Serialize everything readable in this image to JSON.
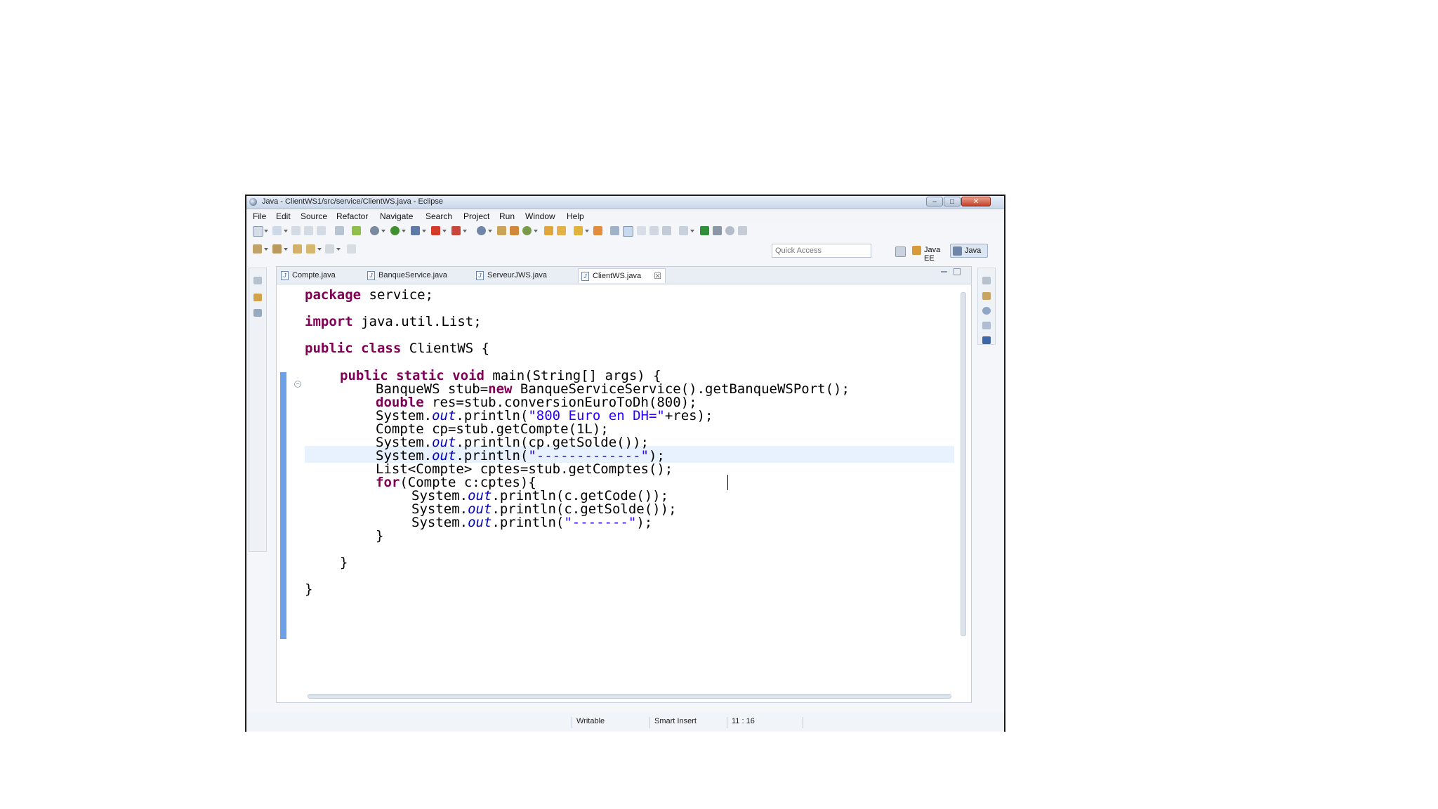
{
  "window": {
    "title": "Java - ClientWS1/src/service/ClientWS.java - Eclipse",
    "controls": {
      "minimize": "–",
      "maximize": "□",
      "close": "✕"
    }
  },
  "menu": [
    "File",
    "Edit",
    "Source",
    "Refactor",
    "Navigate",
    "Search",
    "Project",
    "Run",
    "Window",
    "Help"
  ],
  "quick_access": {
    "placeholder": "Quick Access"
  },
  "perspectives": [
    {
      "label": "Java EE",
      "icon": "java-ee-perspective-icon"
    },
    {
      "label": "Java",
      "icon": "java-perspective-icon",
      "active": true
    }
  ],
  "tabs": [
    {
      "label": "Compte.java"
    },
    {
      "label": "BanqueService.java"
    },
    {
      "label": "ServeurJWS.java"
    },
    {
      "label": "ClientWS.java",
      "active": true,
      "close": "☒"
    }
  ],
  "code": {
    "l1_kw": "package",
    "l1_rest": " service;",
    "l2_kw": "import",
    "l2_rest": " java.util.List;",
    "l3_kw1": "public",
    "l3_kw2": "class",
    "l3_rest": " ClientWS {",
    "l4_kw1": "public",
    "l4_kw2": "static",
    "l4_kw3": "void",
    "l4_rest": " main(String[] args) {",
    "l5_a": "BanqueWS stub=",
    "l5_kw": "new",
    "l5_b": " BanqueServiceService().getBanqueWSPort();",
    "l6_kw": "double",
    "l6_rest": " res=stub.conversionEuroToDh(800);",
    "l7_a": "System.",
    "l7_fld": "out",
    "l7_b": ".println(",
    "l7_str": "\"800 Euro en DH=\"",
    "l7_c": "+res);",
    "l8": "Compte cp=stub.getCompte(1L);",
    "l9_a": "System.",
    "l9_fld": "out",
    "l9_b": ".println(cp.getSolde());",
    "l10_a": "System.",
    "l10_fld": "out",
    "l10_b": ".println(",
    "l10_str": "\"-------------\"",
    "l10_c": ");",
    "l11": "List<Compte> cptes=stub.getComptes();",
    "l12_kw": "for",
    "l12_rest": "(Compte c:cptes){",
    "l13_a": "System.",
    "l13_fld": "out",
    "l13_b": ".println(c.getCode());",
    "l14_a": "System.",
    "l14_fld": "out",
    "l14_b": ".println(c.getSolde());",
    "l15_a": "System.",
    "l15_fld": "out",
    "l15_b": ".println(",
    "l15_str": "\"-------\"",
    "l15_c": ");",
    "l16": "}",
    "l17": "}",
    "l18": "}"
  },
  "status": {
    "writable": "Writable",
    "insert_mode": "Smart Insert",
    "position": "11 : 16"
  },
  "colors": {
    "keyword": "#7f0055",
    "string": "#2a00ff",
    "field": "#0000c0",
    "current_line": "#e8f2fe",
    "ruler": "#6da1e6"
  }
}
